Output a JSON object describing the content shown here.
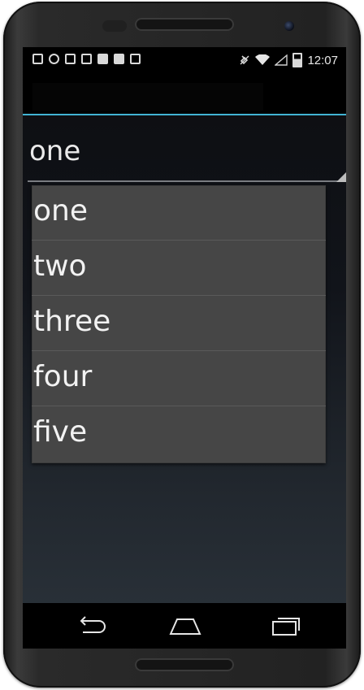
{
  "status_bar": {
    "time": "12:07",
    "left_icons": [
      "notification-icon",
      "settings-icon",
      "download-icon",
      "image-icon",
      "barcode-icon",
      "bag-icon",
      "check-bag-icon"
    ],
    "right_icons": [
      "mute-icon",
      "wifi-icon",
      "signal-icon",
      "battery-icon"
    ]
  },
  "spinner": {
    "selected_value": "one"
  },
  "dropdown": {
    "items": [
      "one",
      "two",
      "three",
      "four",
      "five"
    ]
  },
  "nav_bar": {
    "buttons": [
      "back-icon",
      "home-icon",
      "recent-apps-icon"
    ]
  },
  "colors": {
    "accent": "#41b3d3",
    "dropdown_bg": "#464646",
    "statusbar_bg": "#000000"
  }
}
